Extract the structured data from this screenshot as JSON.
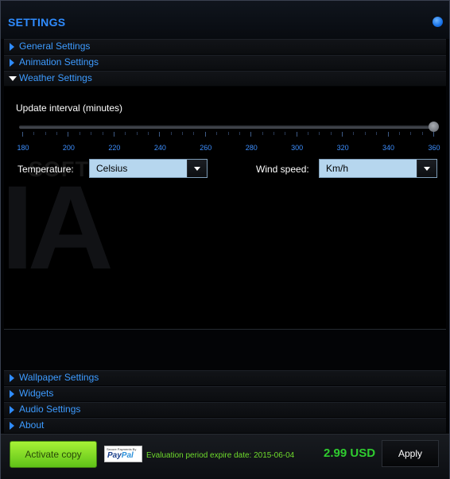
{
  "window": {
    "title": "SETTINGS",
    "accent": "#2f8cff"
  },
  "sections_top": [
    {
      "label": "General Settings",
      "expanded": false
    },
    {
      "label": "Animation Settings",
      "expanded": false
    },
    {
      "label": "Weather Settings",
      "expanded": true
    }
  ],
  "weather": {
    "update_interval_label": "Update interval (minutes)",
    "slider": {
      "min": 180,
      "max": 360,
      "value": 360,
      "tick_labels": [
        "180",
        "200",
        "220",
        "240",
        "260",
        "280",
        "300",
        "320",
        "340",
        "360"
      ]
    },
    "temperature_label": "Temperature:",
    "temperature_value": "Celsius",
    "wind_speed_label": "Wind speed:",
    "wind_speed_value": "Km/h"
  },
  "watermark": {
    "text": "SOFTPEDIA",
    "big": "IA"
  },
  "sections_bottom": [
    {
      "label": "Wallpaper Settings",
      "expanded": false
    },
    {
      "label": "Widgets",
      "expanded": false
    },
    {
      "label": "Audio Settings",
      "expanded": false
    },
    {
      "label": "About",
      "expanded": false
    }
  ],
  "footer": {
    "activate_label": "Activate copy",
    "paypal_small": "Secure Payments By",
    "paypal_logo_a": "Pay",
    "paypal_logo_b": "Pal",
    "expire_text": "Evaluation period expire date: 2015-06-04",
    "price": "2.99 USD",
    "apply_label": "Apply"
  }
}
